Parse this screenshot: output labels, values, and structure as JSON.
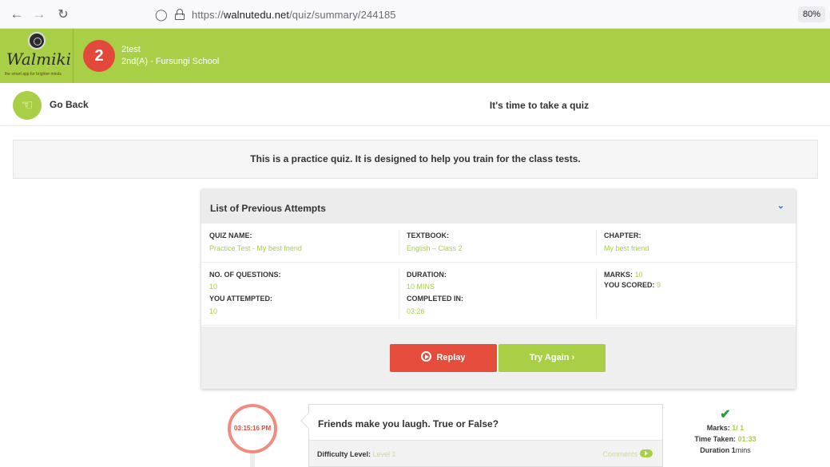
{
  "browser": {
    "url_prefix": "https://",
    "url_host": "walnutedu.net",
    "url_path": "/quiz/summary/244185",
    "zoom": "80%"
  },
  "header": {
    "logo_text": "Walmiki",
    "logo_tagline": "the smart app for brighter minds",
    "step_number": "2",
    "student_name": "2test",
    "student_class": "2nd(A) - Fursungi School",
    "bg_color": "#a8cf45"
  },
  "nav": {
    "go_back_label": "Go Back",
    "page_title": "It's time to take a quiz"
  },
  "banner": {
    "text": "This is a practice quiz. It is designed to help you train for the class tests."
  },
  "attempts": {
    "title": "List of Previous Attempts",
    "quiz_name_label": "QUIZ NAME:",
    "quiz_name": "Practice Test - My best friend",
    "textbook_label": "TEXTBOOK:",
    "textbook": "English – Class 2",
    "chapter_label": "CHAPTER:",
    "chapter": "My best friend",
    "questions_label": "NO. OF QUESTIONS:",
    "questions": "10",
    "attempted_label": "YOU ATTEMPTED:",
    "attempted": "10",
    "duration_label": "DURATION:",
    "duration": "10 MINS",
    "completed_label": "COMPLETED IN:",
    "completed": "03:26",
    "marks_label": "MARKS:",
    "marks": "10",
    "scored_label": "YOU SCORED:",
    "scored": "9",
    "replay_label": "Replay",
    "try_again_label": "Try Again",
    "try_again_arrow": "›"
  },
  "question": {
    "time": "03:15:16 PM",
    "text": "Friends make you laugh. True or False?",
    "difficulty_label": "Difficulty Level:",
    "difficulty": "Level 1",
    "comments_label": "Comments",
    "marks_label": "Marks:",
    "marks": "1/ 1",
    "time_taken_label": "Time Taken:",
    "time_taken": "01:33",
    "duration_label": "Duration",
    "duration_value": "1",
    "duration_unit": "mins"
  }
}
